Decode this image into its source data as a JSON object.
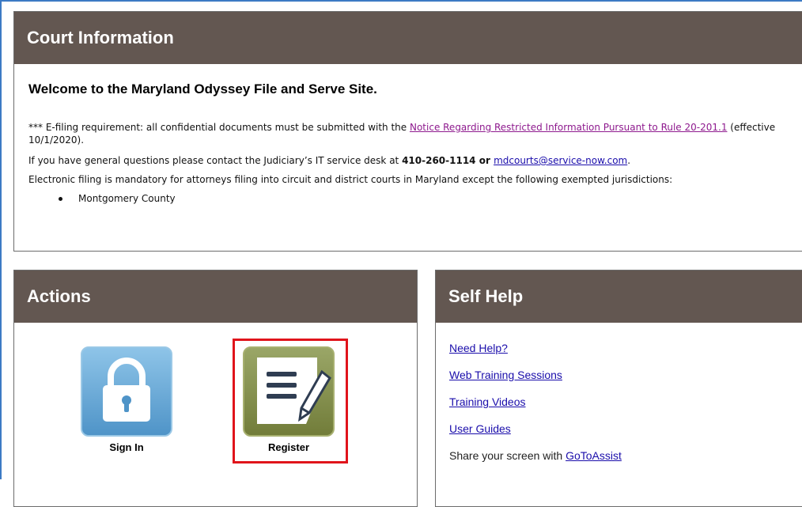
{
  "court": {
    "title": "Court Information",
    "welcome": "Welcome to the Maryland Odyssey File and Serve Site.",
    "efiling_prefix": "*** E-filing requirement: all confidential documents must be submitted with the ",
    "efiling_link": "Notice Regarding Restricted Information Pursuant to Rule 20-201.1",
    "efiling_suffix": " (effective 10/1/2020).",
    "questions_prefix": "If you have general questions please contact the Judiciary’s IT service desk at ",
    "questions_phone": "410-260-1114",
    "questions_mid": " or ",
    "questions_email": "mdcourts@service-now.com",
    "questions_suffix": ".",
    "mandatory": "Electronic filing is mandatory for attorneys filing into circuit and district courts in Maryland except the following exempted jurisdictions:",
    "exempt_items": [
      "Montgomery County"
    ]
  },
  "actions": {
    "title": "Actions",
    "signin_label": "Sign In",
    "register_label": "Register",
    "signin_icon": "lock-icon",
    "register_icon": "document-pen-icon"
  },
  "selfhelp": {
    "title": "Self Help",
    "links": [
      "Need Help?",
      "Web Training Sessions",
      "Training Videos",
      "User Guides"
    ],
    "share_prefix": "Share your screen with ",
    "share_link": "GoToAssist"
  },
  "colors": {
    "header_bg": "#635751",
    "signin_tile": "#5b9fd1",
    "register_tile": "#7f8a45",
    "highlight": "#e0141b",
    "link": "#1a0dab",
    "visited_link": "#8e1a8e"
  }
}
